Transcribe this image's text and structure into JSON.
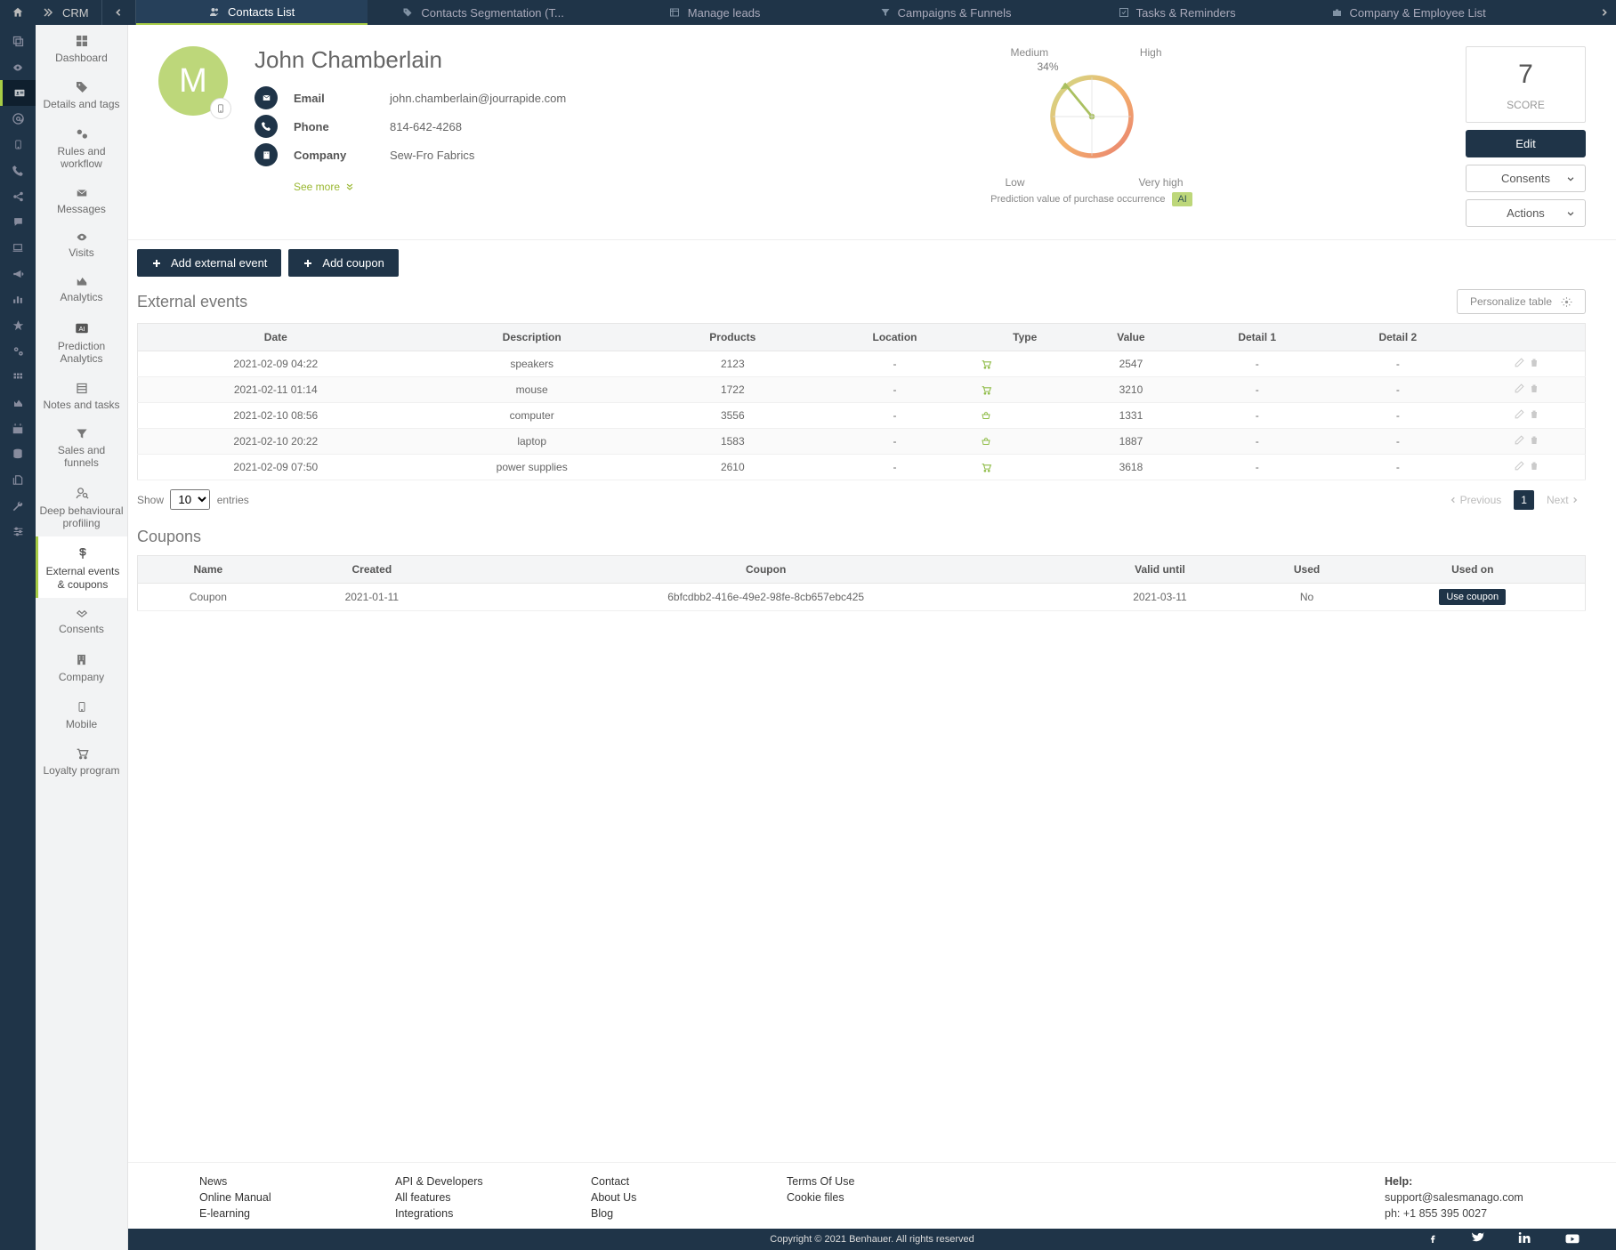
{
  "topbar": {
    "brand": "CRM",
    "tabs": [
      {
        "label": "Contacts List"
      },
      {
        "label": "Contacts Segmentation (T..."
      },
      {
        "label": "Manage leads"
      },
      {
        "label": "Campaigns & Funnels"
      },
      {
        "label": "Tasks & Reminders"
      },
      {
        "label": "Company & Employee List"
      }
    ]
  },
  "sidebar": [
    {
      "label": "Dashboard"
    },
    {
      "label": "Details and tags"
    },
    {
      "label": "Rules and workflow"
    },
    {
      "label": "Messages"
    },
    {
      "label": "Visits"
    },
    {
      "label": "Analytics"
    },
    {
      "label": "Prediction Analytics"
    },
    {
      "label": "Notes and tasks"
    },
    {
      "label": "Sales and funnels"
    },
    {
      "label": "Deep behavioural profiling"
    },
    {
      "label": "External events & coupons"
    },
    {
      "label": "Consents"
    },
    {
      "label": "Company"
    },
    {
      "label": "Mobile"
    },
    {
      "label": "Loyalty program"
    }
  ],
  "contact": {
    "initial": "M",
    "name": "John Chamberlain",
    "email_label": "Email",
    "email": "john.chamberlain@jourrapide.com",
    "phone_label": "Phone",
    "phone": "814-642-4268",
    "company_label": "Company",
    "company": "Sew-Fro Fabrics",
    "see_more": "See more"
  },
  "gauge": {
    "low": "Low",
    "medium": "Medium",
    "high": "High",
    "veryhigh": "Very high",
    "percent": "34%",
    "caption": "Prediction value of purchase occurrence",
    "ai": "AI"
  },
  "score": {
    "value": "7",
    "label": "SCORE",
    "edit": "Edit",
    "consents": "Consents",
    "actions": "Actions"
  },
  "buttons": {
    "add_event": "Add external event",
    "add_coupon": "Add coupon",
    "personalize": "Personalize table"
  },
  "events": {
    "title": "External events",
    "headers": [
      "Date",
      "Description",
      "Products",
      "Location",
      "Type",
      "Value",
      "Detail 1",
      "Detail 2",
      ""
    ],
    "rows": [
      {
        "date": "2021-02-09 04:22",
        "desc": "speakers",
        "prod": "2123",
        "loc": "-",
        "type": "cart",
        "val": "2547",
        "d1": "-",
        "d2": "-"
      },
      {
        "date": "2021-02-11 01:14",
        "desc": "mouse",
        "prod": "1722",
        "loc": "-",
        "type": "cart",
        "val": "3210",
        "d1": "-",
        "d2": "-"
      },
      {
        "date": "2021-02-10 08:56",
        "desc": "computer",
        "prod": "3556",
        "loc": "-",
        "type": "basket",
        "val": "1331",
        "d1": "-",
        "d2": "-"
      },
      {
        "date": "2021-02-10 20:22",
        "desc": "laptop",
        "prod": "1583",
        "loc": "-",
        "type": "basket",
        "val": "1887",
        "d1": "-",
        "d2": "-"
      },
      {
        "date": "2021-02-09 07:50",
        "desc": "power supplies",
        "prod": "2610",
        "loc": "-",
        "type": "cart",
        "val": "3618",
        "d1": "-",
        "d2": "-"
      }
    ],
    "show": "Show",
    "entries": "entries",
    "page_size": "10",
    "prev": "Previous",
    "next": "Next",
    "page": "1"
  },
  "coupons": {
    "title": "Coupons",
    "headers": [
      "Name",
      "Created",
      "Coupon",
      "Valid until",
      "Used",
      "Used on"
    ],
    "rows": [
      {
        "name": "Coupon",
        "created": "2021-01-11",
        "code": "6bfcdbb2-416e-49e2-98fe-8cb657ebc425",
        "valid": "2021-03-11",
        "used": "No",
        "action": "Use coupon"
      }
    ]
  },
  "footer": {
    "col1": [
      "News",
      "Online Manual",
      "E-learning"
    ],
    "col2": [
      "API & Developers",
      "All features",
      "Integrations"
    ],
    "col3": [
      "Contact",
      "About Us",
      "Blog"
    ],
    "col4": [
      "Terms Of Use",
      "Cookie files"
    ],
    "help_title": "Help:",
    "help_email": "support@salesmanago.com",
    "help_phone": "ph: +1 855 395 0027",
    "copyright": "Copyright © 2021 Benhauer. All rights reserved"
  }
}
